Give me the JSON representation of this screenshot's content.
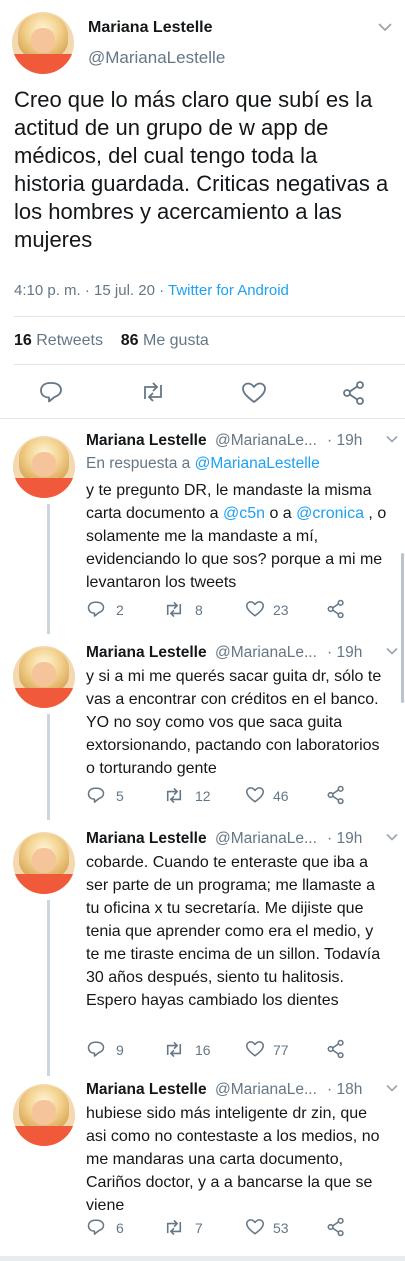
{
  "main_tweet": {
    "name": "Mariana Lestelle",
    "handle": "@MarianaLestelle",
    "text": "Creo que lo más claro que  subí es la actitud de un grupo de w app de médicos, del cual tengo toda la historia guardada. Criticas negativas a los hombres y acercamiento a las mujeres",
    "time": "4:10 p. m.",
    "date": "15 jul. 20",
    "source": "Twitter for Android",
    "retweets_count": "16",
    "retweets_label": "Retweets",
    "likes_count": "86",
    "likes_label": "Me gusta"
  },
  "replies": [
    {
      "name": "Mariana Lestelle",
      "handle": "@MarianaLe...",
      "time": "19h",
      "in_reply_prefix": "En respuesta a",
      "in_reply_handle": "@MarianaLestelle",
      "text_parts": [
        "y te pregunto DR, le mandaste la misma carta documento a  ",
        "@c5n",
        " o a ",
        "@cronica",
        " , o solamente me la mandaste a mí, evidenciando lo que sos? porque a mi me levantaron los tweets"
      ],
      "replies": "2",
      "retweets": "8",
      "likes": "23"
    },
    {
      "name": "Mariana Lestelle",
      "handle": "@MarianaLe...",
      "time": "19h",
      "text": "y si a mi me querés sacar guita dr, sólo te vas a encontrar con créditos en el banco. YO no soy como vos que saca guita extorsionando, pactando con laboratorios o torturando gente",
      "replies": "5",
      "retweets": "12",
      "likes": "46"
    },
    {
      "name": "Mariana Lestelle",
      "handle": "@MarianaLe...",
      "time": "19h",
      "text": "cobarde. Cuando te enteraste que iba a ser parte de un programa; me llamaste a tu oficina x  tu secretaría. Me dijiste que tenia que aprender como era el medio, y te me tiraste encima de un sillon. Todavía 30 años después, siento tu halitosis. Espero hayas cambiado los dientes",
      "replies": "9",
      "retweets": "16",
      "likes": "77"
    },
    {
      "name": "Mariana Lestelle",
      "handle": "@MarianaLe...",
      "time": "18h",
      "text": "hubiese sido más inteligente dr zin, que asi como no contestaste a los medios, no me mandaras una carta documento, Cariños doctor, y a a bancarse la que se viene",
      "replies": "6",
      "retweets": "7",
      "likes": "53"
    }
  ],
  "icons": [
    "reply-icon",
    "retweet-icon",
    "like-icon",
    "share-icon",
    "chevron-down-icon"
  ],
  "colors": {
    "accent": "#1da1f2",
    "secondary_text": "#657786",
    "primary_text": "#14171a"
  }
}
